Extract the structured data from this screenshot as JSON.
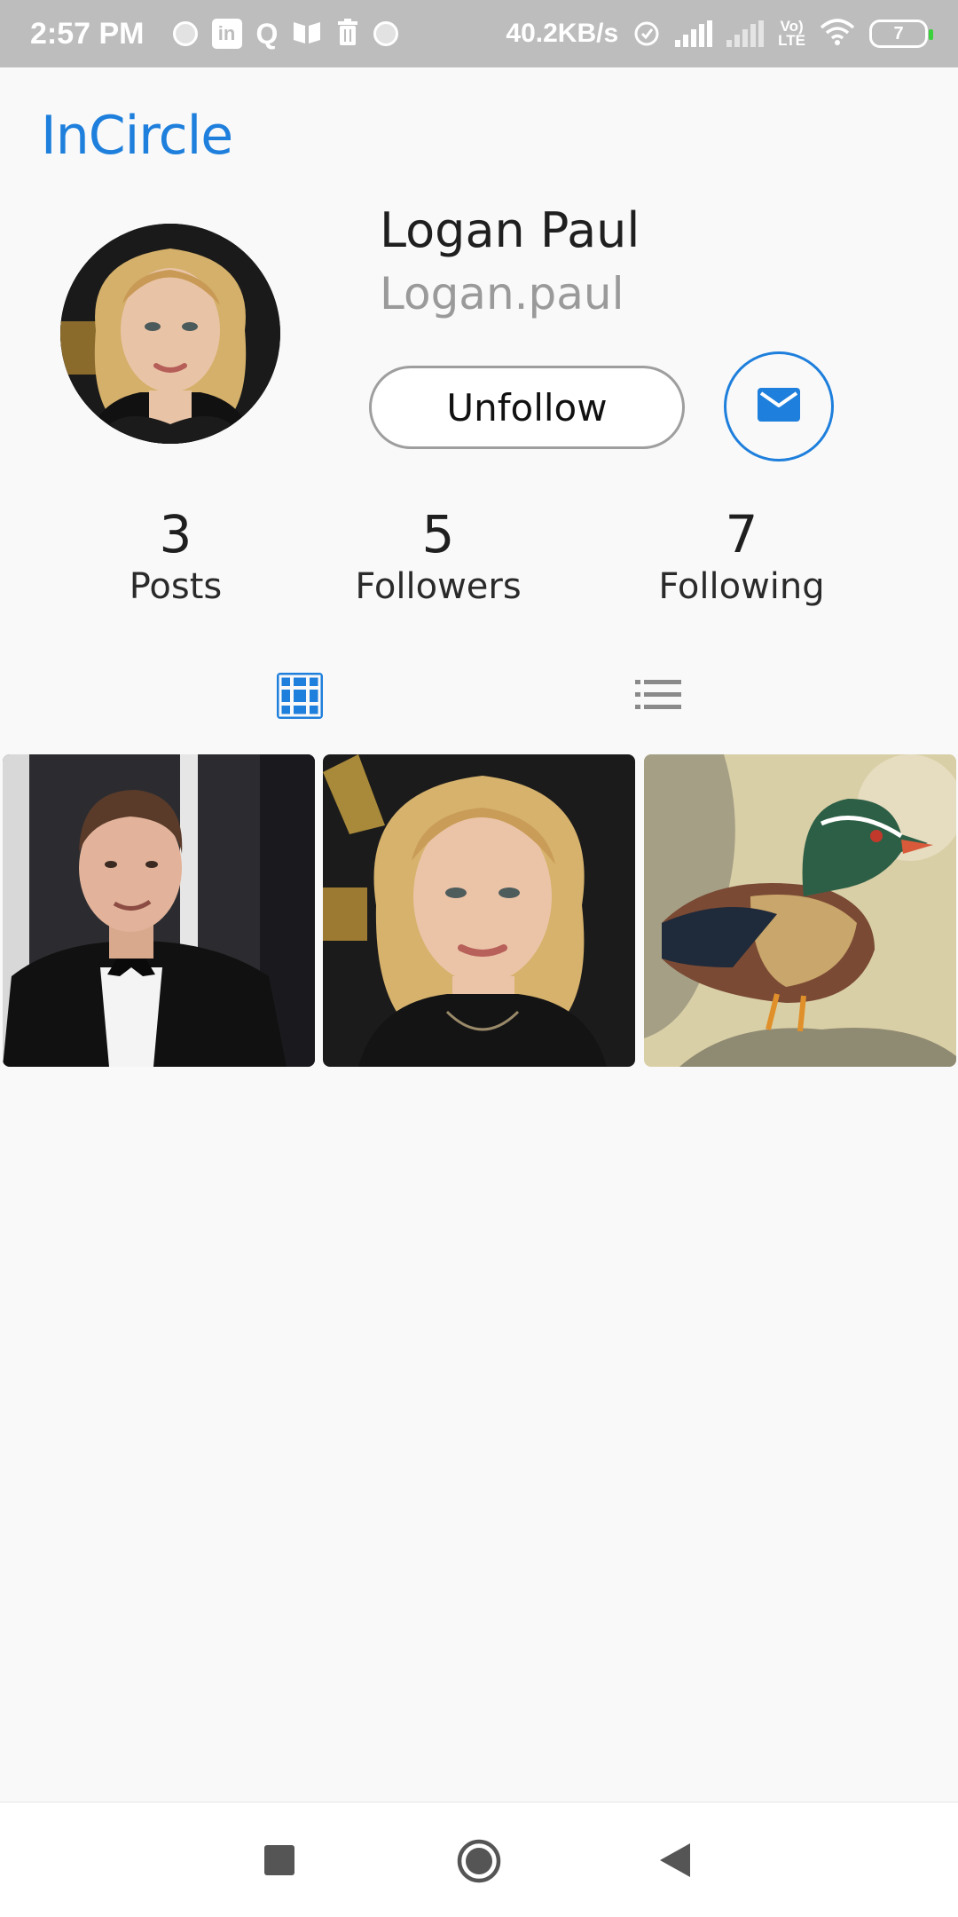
{
  "status_bar": {
    "time": "2:57 PM",
    "network_speed": "40.2KB/s",
    "battery_level": "7",
    "lte_label_top": "Vo)",
    "lte_label_bottom": "LTE",
    "notification_icons": [
      "circle-icon",
      "linkedin-icon",
      "quora-icon",
      "book-icon",
      "trash-icon",
      "circle-icon"
    ],
    "linkedin_glyph": "in",
    "quora_glyph": "Q"
  },
  "header": {
    "app_title": "InCircle"
  },
  "profile": {
    "name": "Logan Paul",
    "handle": "Logan.paul",
    "unfollow_label": "Unfollow",
    "message_icon": "mail-icon"
  },
  "stats": [
    {
      "count": "3",
      "label": "Posts"
    },
    {
      "count": "5",
      "label": "Followers"
    },
    {
      "count": "7",
      "label": "Following"
    }
  ],
  "tabs": {
    "grid_icon": "grid-view-icon",
    "list_icon": "list-view-icon",
    "active": "grid"
  },
  "posts": [
    {
      "subject": "man-in-tuxedo-photo"
    },
    {
      "subject": "woman-portrait-photo"
    },
    {
      "subject": "wood-duck-photo"
    }
  ],
  "nav": {
    "icons": [
      "recents-icon",
      "home-icon",
      "back-icon"
    ]
  },
  "colors": {
    "accent": "#1e7fdc",
    "status_bar": "#bdbdbd",
    "background": "#f9f9f9"
  }
}
